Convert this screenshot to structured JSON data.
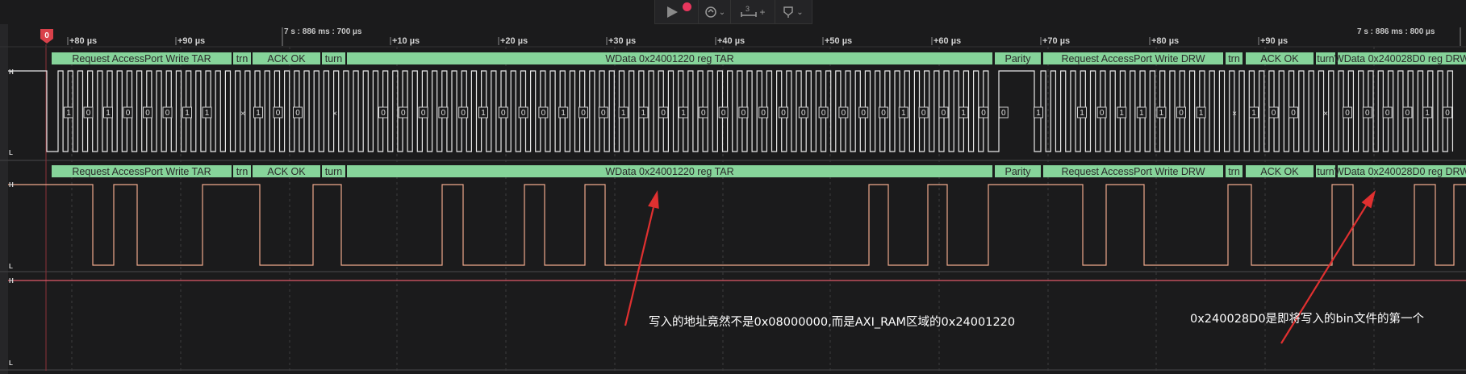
{
  "toolbar": {
    "run_button_icon": "play-icon",
    "record_indicator_color": "#e8365d",
    "trigger_icon": "trigger-icon",
    "measure_count": "3",
    "measure_plus": "+",
    "marker_icon": "marker-icon",
    "chevron": "⌄"
  },
  "timeline": {
    "marker_badge": "0",
    "abs_left": "7 s : 886 ms : 700 µs",
    "abs_right": "7 s : 886 ms : 800 µs",
    "ticks_first": [
      "+80 µs",
      "+90 µs"
    ],
    "ticks_second": [
      "+10 µs",
      "+20 µs",
      "+30 µs",
      "+40 µs",
      "+50 µs",
      "+60 µs",
      "+70 µs",
      "+80 µs",
      "+90 µs"
    ]
  },
  "channels": {
    "clock": {
      "high_label": "H",
      "low_label": "L",
      "color": "#e8e8e8"
    },
    "data": {
      "high_label": "H",
      "low_label": "L",
      "color": "#f0a98c"
    },
    "third": {
      "high_label": "H",
      "low_label": "L",
      "color": "#e05a6a"
    }
  },
  "protocol": {
    "segment_color": "#86d49a",
    "segments": [
      "Request AccessPort Write TAR",
      "trn",
      "ACK OK",
      "turn",
      "WData 0x24001220 reg TAR",
      "Parity",
      "Request AccessPort Write DRW",
      "trn",
      "ACK OK",
      "turn",
      "WData 0x240028D0 reg DRW"
    ]
  },
  "bits": {
    "group1": [
      "1",
      "0",
      "1",
      "0",
      "0",
      "0",
      "1",
      "1"
    ],
    "turn1": "×",
    "ack1": [
      "1",
      "0",
      "0"
    ],
    "turn2": "×",
    "wdata1": [
      "0",
      "0",
      "0",
      "0",
      "0",
      "1",
      "0",
      "0",
      "0",
      "1",
      "0",
      "0",
      "1",
      "1",
      "0",
      "1",
      "0",
      "0",
      "0",
      "0",
      "0",
      "0",
      "0",
      "0",
      "0",
      "0",
      "1",
      "0",
      "0",
      "1",
      "0",
      "0"
    ],
    "parity_bit": "1",
    "group2": [
      "1",
      "0",
      "1",
      "1",
      "1",
      "0",
      "1"
    ],
    "turn3": "×",
    "ack2": [
      "1",
      "0",
      "0"
    ],
    "turn4": "×",
    "wdata2": [
      "0",
      "0",
      "0",
      "0",
      "1",
      "0"
    ]
  },
  "annotations": {
    "arrow_color": "#e03030",
    "note1": "写入的地址竟然不是0x08000000,而是AXI_RAM区域的0x24001220",
    "note2": "0x240028D0是即将写入的bin文件的第一个"
  }
}
